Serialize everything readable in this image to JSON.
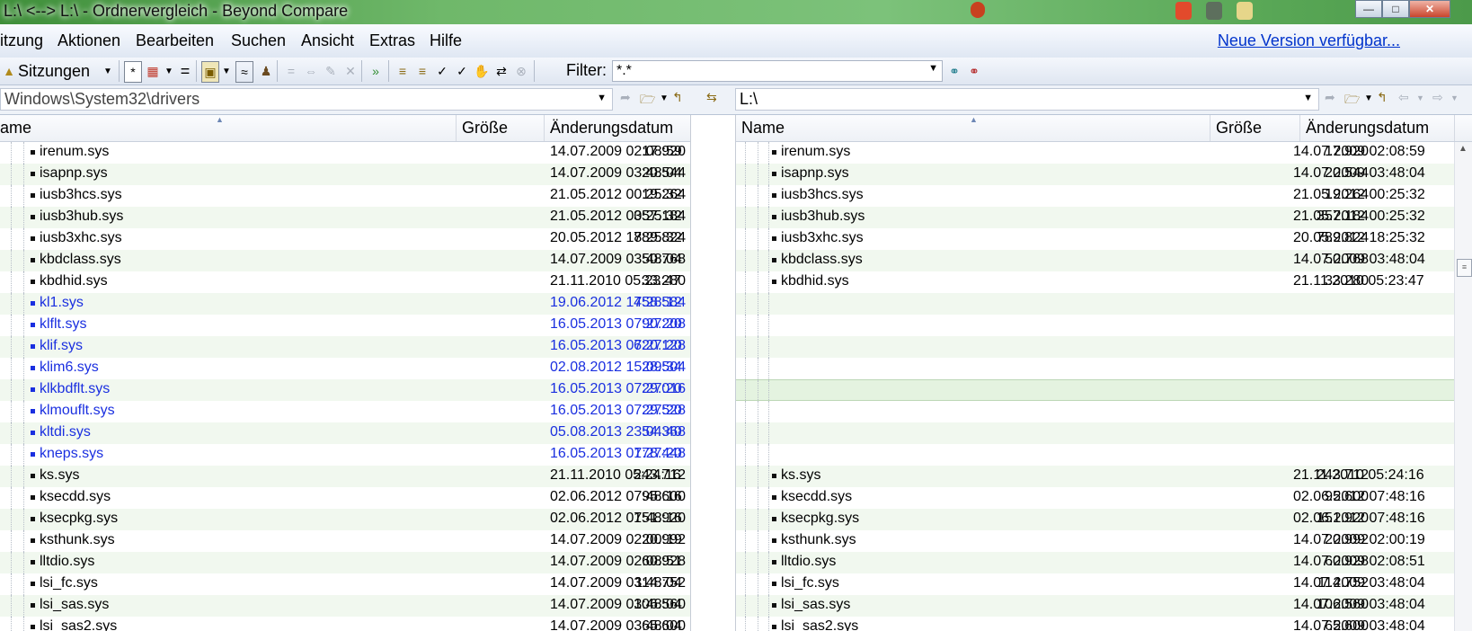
{
  "window": {
    "title": "L:\\ <--> L:\\ - Ordnervergleich - Beyond Compare"
  },
  "menu": {
    "items": [
      "itzung",
      "Aktionen",
      "Bearbeiten",
      "Suchen",
      "Ansicht",
      "Extras",
      "Hilfe"
    ],
    "new_version": "Neue Version verfügbar..."
  },
  "toolbar": {
    "sessions_label": "Sitzungen",
    "equals_label": "=",
    "filter_label": "Filter:",
    "filter_value": "*.*"
  },
  "left_panel": {
    "path": "Windows\\System32\\drivers",
    "columns": [
      "ame",
      "Größe",
      "Änderungsdatum"
    ]
  },
  "right_panel": {
    "path": "L:\\",
    "columns": [
      "Name",
      "Größe",
      "Änderungsdatum"
    ]
  },
  "left_rows": [
    {
      "name": "irenum.sys",
      "size": "17.920",
      "date": "14.07.2009 02:08:59",
      "status": "same"
    },
    {
      "name": "isapnp.sys",
      "size": "20.544",
      "date": "14.07.2009 03:48:04",
      "status": "same"
    },
    {
      "name": "iusb3hcs.sys",
      "size": "19.264",
      "date": "21.05.2012 00:25:32",
      "status": "same"
    },
    {
      "name": "iusb3hub.sys",
      "size": "357.184",
      "date": "21.05.2012 00:25:32",
      "status": "same"
    },
    {
      "name": "iusb3xhc.sys",
      "size": "789.824",
      "date": "20.05.2012 18:25:32",
      "status": "same"
    },
    {
      "name": "kbdclass.sys",
      "size": "50.768",
      "date": "14.07.2009 03:48:04",
      "status": "same"
    },
    {
      "name": "kbdhid.sys",
      "size": "33.280",
      "date": "21.11.2010 05:23:47",
      "status": "same"
    },
    {
      "name": "kl1.sys",
      "size": "458.584",
      "date": "19.06.2012 17:28:12",
      "status": "orphan"
    },
    {
      "name": "klflt.sys",
      "size": "90.208",
      "date": "16.05.2013 07:27:20",
      "status": "orphan"
    },
    {
      "name": "klif.sys",
      "size": "620.128",
      "date": "16.05.2013 07:27:20",
      "status": "orphan"
    },
    {
      "name": "klim6.sys",
      "size": "28.504",
      "date": "02.08.2012 15:09:34",
      "status": "orphan"
    },
    {
      "name": "klkbdflt.sys",
      "size": "29.016",
      "date": "16.05.2013 07:27:20",
      "status": "orphan"
    },
    {
      "name": "klmouflt.sys",
      "size": "29.528",
      "date": "16.05.2013 07:27:20",
      "status": "orphan"
    },
    {
      "name": "kltdi.sys",
      "size": "54.368",
      "date": "05.08.2013 23:04:40",
      "status": "orphan"
    },
    {
      "name": "kneps.sys",
      "size": "178.448",
      "date": "16.05.2013 07:27:20",
      "status": "orphan"
    },
    {
      "name": "ks.sys",
      "size": "243.712",
      "date": "21.11.2010 05:24:16",
      "status": "same"
    },
    {
      "name": "ksecdd.sys",
      "size": "95.600",
      "date": "02.06.2012 07:48:16",
      "status": "same"
    },
    {
      "name": "ksecpkg.sys",
      "size": "151.920",
      "date": "02.06.2012 07:48:16",
      "status": "same"
    },
    {
      "name": "ksthunk.sys",
      "size": "20.992",
      "date": "14.07.2009 02:00:19",
      "status": "same"
    },
    {
      "name": "lltdio.sys",
      "size": "60.928",
      "date": "14.07.2009 02:08:51",
      "status": "same"
    },
    {
      "name": "lsi_fc.sys",
      "size": "114.752",
      "date": "14.07.2009 03:48:04",
      "status": "same"
    },
    {
      "name": "lsi_sas.sys",
      "size": "106.560",
      "date": "14.07.2009 03:48:04",
      "status": "same"
    },
    {
      "name": "lsi_sas2.sys",
      "size": "65.600",
      "date": "14.07.2009 03:48:04",
      "status": "same"
    }
  ],
  "right_rows": [
    {
      "name": "irenum.sys",
      "size": "17.920",
      "date": "14.07.2009 02:08:59"
    },
    {
      "name": "isapnp.sys",
      "size": "20.544",
      "date": "14.07.2009 03:48:04"
    },
    {
      "name": "iusb3hcs.sys",
      "size": "19.264",
      "date": "21.05.2012 00:25:32"
    },
    {
      "name": "iusb3hub.sys",
      "size": "357.184",
      "date": "21.05.2012 00:25:32"
    },
    {
      "name": "iusb3xhc.sys",
      "size": "789.824",
      "date": "20.05.2012 18:25:32"
    },
    {
      "name": "kbdclass.sys",
      "size": "50.768",
      "date": "14.07.2009 03:48:04"
    },
    {
      "name": "kbdhid.sys",
      "size": "33.280",
      "date": "21.11.2010 05:23:47"
    },
    {
      "name": "",
      "size": "",
      "date": ""
    },
    {
      "name": "",
      "size": "",
      "date": ""
    },
    {
      "name": "",
      "size": "",
      "date": ""
    },
    {
      "name": "",
      "size": "",
      "date": ""
    },
    {
      "name": "",
      "size": "",
      "date": "",
      "selected": true
    },
    {
      "name": "",
      "size": "",
      "date": ""
    },
    {
      "name": "",
      "size": "",
      "date": ""
    },
    {
      "name": "",
      "size": "",
      "date": ""
    },
    {
      "name": "ks.sys",
      "size": "243.712",
      "date": "21.11.2010 05:24:16"
    },
    {
      "name": "ksecdd.sys",
      "size": "95.600",
      "date": "02.06.2012 07:48:16"
    },
    {
      "name": "ksecpkg.sys",
      "size": "151.920",
      "date": "02.06.2012 07:48:16"
    },
    {
      "name": "ksthunk.sys",
      "size": "20.992",
      "date": "14.07.2009 02:00:19"
    },
    {
      "name": "lltdio.sys",
      "size": "60.928",
      "date": "14.07.2009 02:08:51"
    },
    {
      "name": "lsi_fc.sys",
      "size": "114.752",
      "date": "14.07.2009 03:48:04"
    },
    {
      "name": "lsi_sas.sys",
      "size": "106.560",
      "date": "14.07.2009 03:48:04"
    },
    {
      "name": "lsi_sas2.sys",
      "size": "65.600",
      "date": "14.07.2009 03:48:04"
    }
  ],
  "colors": {
    "orphan_text": "#1a2fe0",
    "alt_row": "#f1f8ef",
    "titlebar": "#5aa857",
    "link": "#0033cc"
  }
}
